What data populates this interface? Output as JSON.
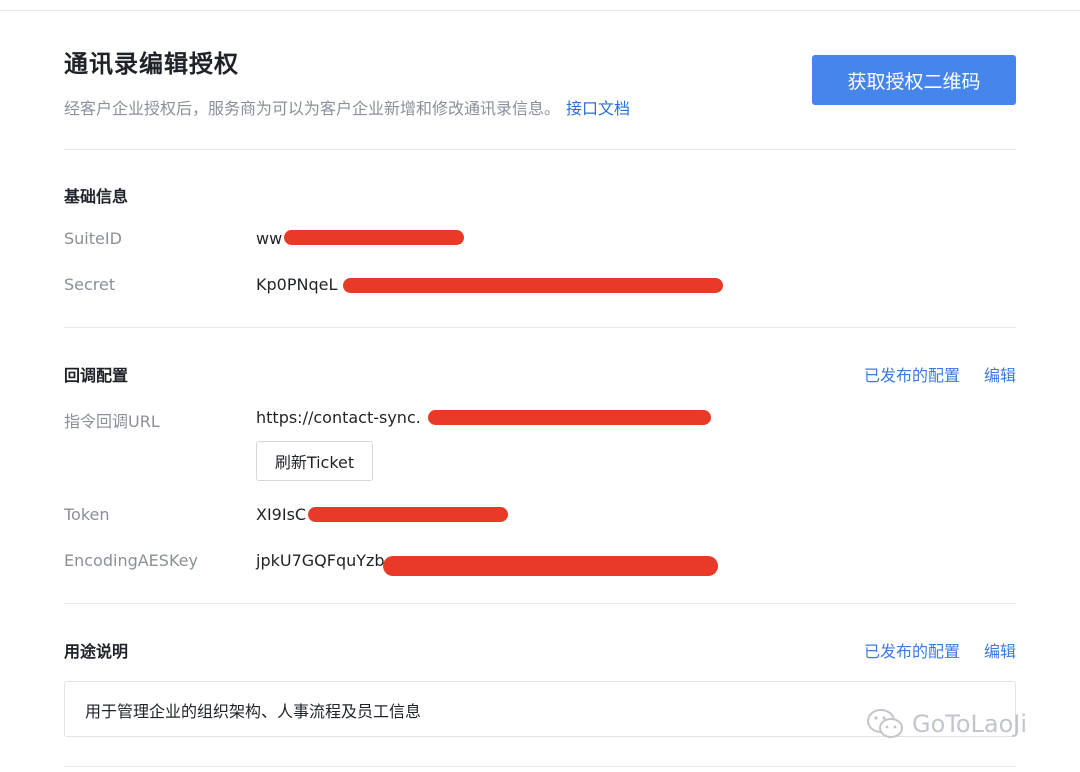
{
  "header": {
    "title": "通讯录编辑授权",
    "description": "经客户企业授权后，服务商为可以为客户企业新增和修改通讯录信息。",
    "doc_link": "接口文档",
    "qr_button": "获取授权二维码"
  },
  "basic_info": {
    "title": "基础信息",
    "fields": [
      {
        "label": "SuiteID",
        "value": "ww"
      },
      {
        "label": "Secret",
        "value": "Kp0PNqeL"
      }
    ]
  },
  "callback": {
    "title": "回调配置",
    "published_link": "已发布的配置",
    "edit_link": "编辑",
    "url_label": "指令回调URL",
    "url_value": "https://contact-sync.",
    "refresh_button": "刷新Ticket",
    "token_label": "Token",
    "token_value": "XI9IsC",
    "aes_label": "EncodingAESKey",
    "aes_value": "jpkU7GQFquYzb"
  },
  "purpose": {
    "title": "用途说明",
    "published_link": "已发布的配置",
    "edit_link": "编辑",
    "text": "用于管理企业的组织架构、人事流程及员工信息"
  },
  "watermark": {
    "text": "GoToLaoJi",
    "icon": "wechat-icon"
  },
  "colors": {
    "primary": "#4685ec",
    "link": "#3b7be0",
    "redaction": "#e83a26"
  }
}
